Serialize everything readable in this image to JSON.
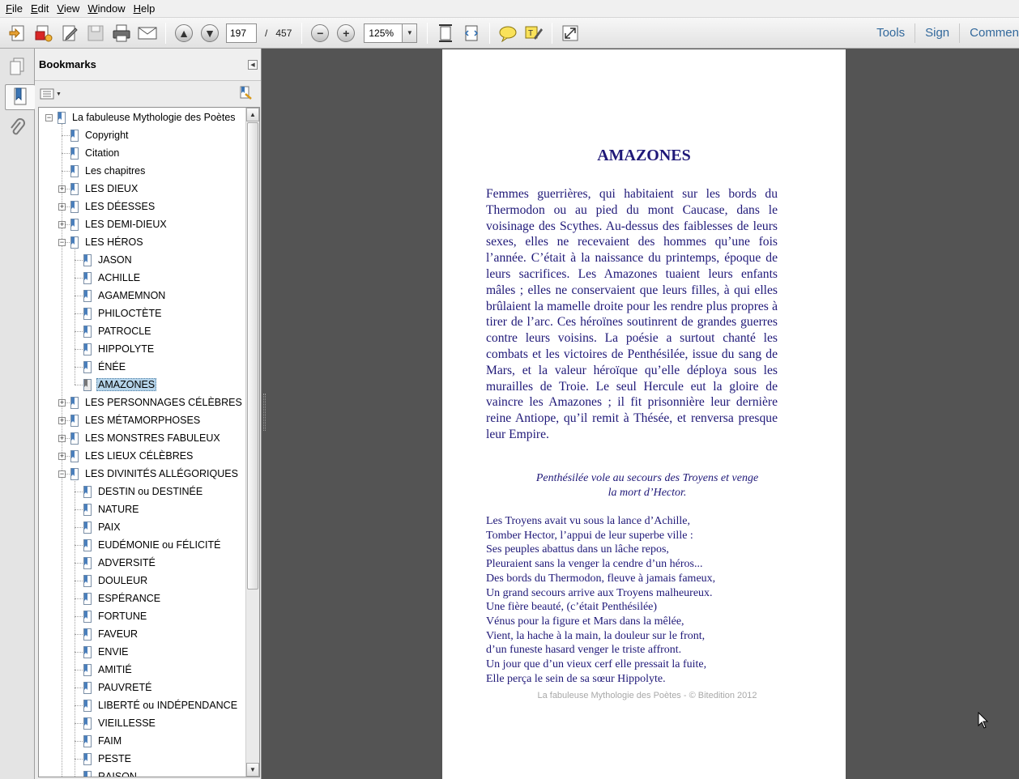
{
  "menubar": {
    "items": [
      {
        "label": "File"
      },
      {
        "label": "Edit"
      },
      {
        "label": "View"
      },
      {
        "label": "Window"
      },
      {
        "label": "Help"
      }
    ]
  },
  "toolbar": {
    "current_page": "197",
    "page_separator": "/",
    "total_pages": "457",
    "zoom": "125%",
    "tools_label": "Tools",
    "sign_label": "Sign",
    "comment_label": "Commen"
  },
  "bookmarks": {
    "title": "Bookmarks",
    "items": [
      {
        "label": "La fabuleuse Mythologie des Poètes",
        "level": 0,
        "expander": "minus"
      },
      {
        "label": "Copyright",
        "level": 1,
        "expander": ""
      },
      {
        "label": "Citation",
        "level": 1,
        "expander": ""
      },
      {
        "label": "Les chapitres",
        "level": 1,
        "expander": ""
      },
      {
        "label": "LES DIEUX",
        "level": 1,
        "expander": "plus"
      },
      {
        "label": "LES DÉESSES",
        "level": 1,
        "expander": "plus"
      },
      {
        "label": "LES DEMI-DIEUX",
        "level": 1,
        "expander": "plus"
      },
      {
        "label": "LES HÉROS",
        "level": 1,
        "expander": "minus"
      },
      {
        "label": "JASON",
        "level": 2,
        "expander": ""
      },
      {
        "label": "ACHILLE",
        "level": 2,
        "expander": ""
      },
      {
        "label": "AGAMEMNON",
        "level": 2,
        "expander": ""
      },
      {
        "label": "PHILOCTÈTE",
        "level": 2,
        "expander": ""
      },
      {
        "label": "PATROCLE",
        "level": 2,
        "expander": ""
      },
      {
        "label": "HIPPOLYTE",
        "level": 2,
        "expander": ""
      },
      {
        "label": "ÉNÉE",
        "level": 2,
        "expander": ""
      },
      {
        "label": "AMAZONES",
        "level": 2,
        "expander": "",
        "selected": true
      },
      {
        "label": "LES PERSONNAGES CÉLÈBRES",
        "level": 1,
        "expander": "plus"
      },
      {
        "label": "LES MÉTAMORPHOSES",
        "level": 1,
        "expander": "plus"
      },
      {
        "label": "LES MONSTRES FABULEUX",
        "level": 1,
        "expander": "plus"
      },
      {
        "label": "LES LIEUX CÉLÈBRES",
        "level": 1,
        "expander": "plus"
      },
      {
        "label": "LES DIVINITÉS ALLÉGORIQUES",
        "level": 1,
        "expander": "minus"
      },
      {
        "label": "DESTIN ou DESTINÉE",
        "level": 2,
        "expander": ""
      },
      {
        "label": "NATURE",
        "level": 2,
        "expander": ""
      },
      {
        "label": "PAIX",
        "level": 2,
        "expander": ""
      },
      {
        "label": "EUDÉMONIE ou FÉLICITÉ",
        "level": 2,
        "expander": ""
      },
      {
        "label": "ADVERSITÉ",
        "level": 2,
        "expander": ""
      },
      {
        "label": "DOULEUR",
        "level": 2,
        "expander": ""
      },
      {
        "label": "ESPÉRANCE",
        "level": 2,
        "expander": ""
      },
      {
        "label": "FORTUNE",
        "level": 2,
        "expander": ""
      },
      {
        "label": "FAVEUR",
        "level": 2,
        "expander": ""
      },
      {
        "label": "ENVIE",
        "level": 2,
        "expander": ""
      },
      {
        "label": "AMITIÉ",
        "level": 2,
        "expander": ""
      },
      {
        "label": "PAUVRETÉ",
        "level": 2,
        "expander": ""
      },
      {
        "label": "LIBERTÉ ou INDÉPENDANCE",
        "level": 2,
        "expander": ""
      },
      {
        "label": "VIEILLESSE",
        "level": 2,
        "expander": ""
      },
      {
        "label": "FAIM",
        "level": 2,
        "expander": ""
      },
      {
        "label": "PESTE",
        "level": 2,
        "expander": ""
      },
      {
        "label": "RAISON",
        "level": 2,
        "expander": ""
      }
    ]
  },
  "document": {
    "title": "AMAZONES",
    "body": "Femmes guerrières, qui habitaient sur les bords du Thermodon ou au pied du mont Caucase, dans le voisinage des Scythes. Au-dessus des faiblesses de leurs sexes, elles ne recevaient des hommes qu’une fois l’année. C’était à la naissance du printemps, époque de leurs sacrifices. Les Amazones tuaient leurs enfants mâles ; elles ne conservaient que leurs filles, à qui elles brûlaient la mamelle droite pour les rendre plus propres à tirer de l’arc. Ces héroïnes soutinrent de grandes guerres contre leurs voisins. La poésie a surtout chanté les combats et les victoires de Penthésilée, issue du sang de Mars, et la valeur héroïque qu’elle déploya sous les murailles de Troie. Le seul Hercule eut la gloire de vaincre les Amazones ; il fit prisonnière leur dernière reine Antiope, qu’il remit à Thésée, et renversa presque leur Empire.",
    "caption_line1": "Penthésilée vole au secours des Troyens et venge",
    "caption_line2": "la mort d’Hector.",
    "poem": [
      "Les Troyens avait vu sous la lance d’Achille,",
      "Tomber Hector, l’appui de leur superbe ville :",
      "Ses peuples abattus dans un lâche repos,",
      "Pleuraient sans la venger la cendre d’un héros...",
      "Des bords du Thermodon, fleuve à jamais fameux,",
      "Un grand secours arrive aux Troyens malheureux.",
      "Une fière beauté, (c’était Penthésilée)",
      "Vénus pour la figure et Mars dans la mêlée,",
      "Vient, la hache à la main, la douleur sur le front,",
      "d’un funeste hasard venger le triste affront.",
      "Un jour que d’un vieux cerf elle pressait la fuite,",
      "Elle perça le sein de sa sœur Hippolyte."
    ],
    "footer": "La fabuleuse Mythologie des Poètes - © Bitedition 2012"
  },
  "colors": {
    "doc_text": "#1f1878",
    "link_blue": "#33699c",
    "selection": "#b6d4ea",
    "viewer_bg": "#545454"
  }
}
